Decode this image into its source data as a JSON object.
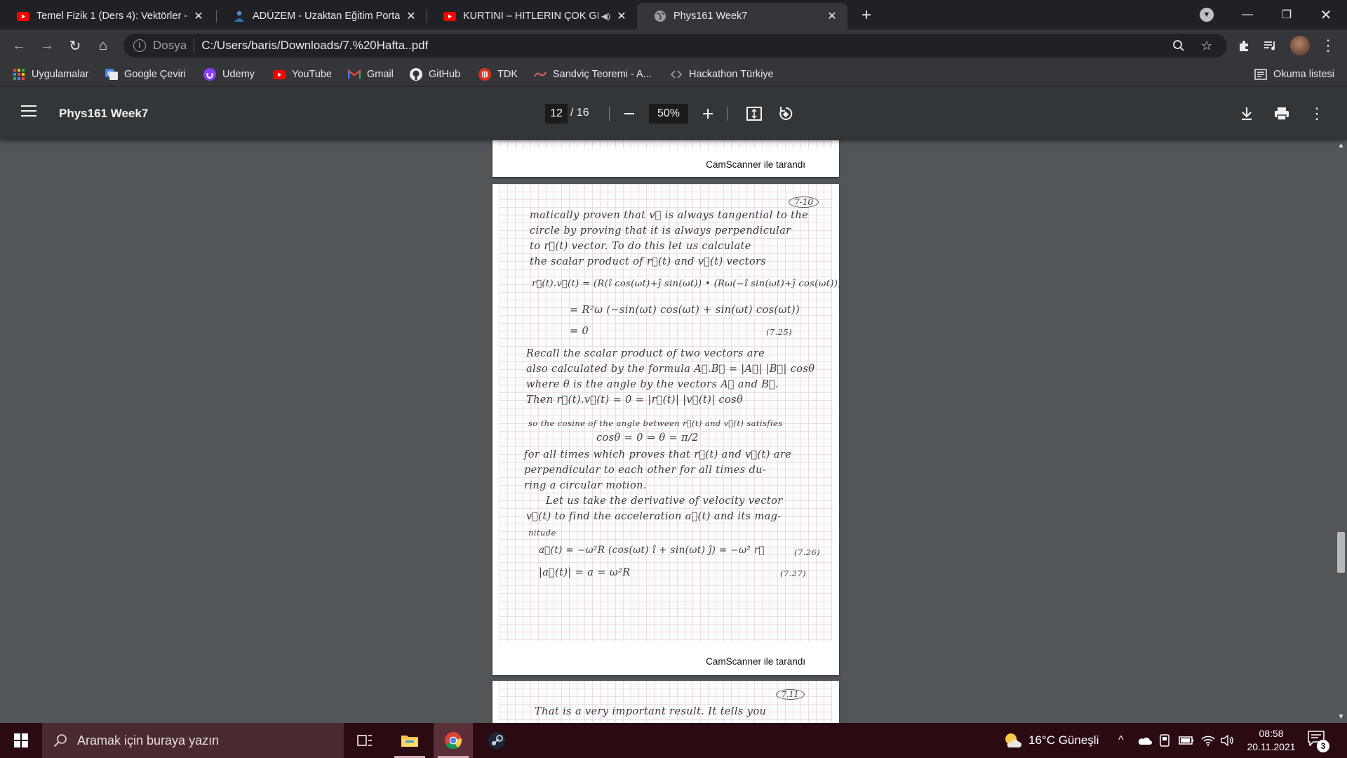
{
  "browser": {
    "tabs": [
      {
        "title": "Temel Fizik 1 (Ders 4): Vektörler -",
        "favicon": "youtube-icon"
      },
      {
        "title": "ADÜZEM - Uzaktan Eğitim Portalı",
        "favicon": "aduzem-icon"
      },
      {
        "title": "KURTİNİ – HİTLERİN ÇOK GİZ",
        "favicon": "youtube-icon",
        "audio": "speaker-icon"
      },
      {
        "title": "Phys161 Week7",
        "favicon": "globe-icon",
        "active": true
      }
    ],
    "address": {
      "scheme": "Dosya",
      "url": "C:/Users/baris/Downloads/7.%20Hafta..pdf"
    },
    "bookmarks": [
      {
        "label": "Uygulamalar",
        "icon": "apps-grid-icon"
      },
      {
        "label": "Google Çeviri",
        "icon": "google-translate-icon"
      },
      {
        "label": "Udemy",
        "icon": "udemy-icon"
      },
      {
        "label": "YouTube",
        "icon": "youtube-icon"
      },
      {
        "label": "Gmail",
        "icon": "gmail-icon"
      },
      {
        "label": "GitHub",
        "icon": "github-icon"
      },
      {
        "label": "TDK",
        "icon": "tdk-icon"
      },
      {
        "label": "Sandviç Teoremi - A...",
        "icon": "bookmark-page-icon"
      },
      {
        "label": "Hackathon Türkiye",
        "icon": "bookmark-page-icon"
      }
    ],
    "reading_list": "Okuma listesi"
  },
  "pdf": {
    "title": "Phys161 Week7",
    "current_page": "12",
    "total_pages": "/ 16",
    "zoom": "50%",
    "scan_footer": "CamScanner ile tarandı",
    "page_top_number": "7-10",
    "next_page_number": "7.11",
    "handwriting": [
      "matically proven that v⃗ is always tangential to the",
      "circle by proving that it is always perpendicular",
      "to r⃗(t) vector. To do this let us calculate",
      "the scalar product of r⃗(t) and v⃗(t) vectors",
      "r⃗(t).v⃗(t) = (R(î cos(ωt)+ĵ sin(ωt)) • (Rω(−î sin(ωt)+ĵ cos(ωt)))",
      "= R²ω (−sin(ωt) cos(ωt) + sin(ωt) cos(ωt))",
      "= 0",
      "(7.25)",
      "Recall the scalar product of two vectors are",
      "also calculated by the formula A⃗.B⃗ = |A⃗| |B⃗| cosθ",
      "where θ is the angle by the vectors A⃗ and B⃗.",
      "Then r⃗(t).v⃗(t) = 0 = |r⃗(t)| |v⃗(t)| cosθ",
      "so the cosine of the angle between r⃗(t) and v⃗(t) satisfies",
      "cosθ = 0  ⇒  θ = π/2",
      "for all times which proves that r⃗(t) and v⃗(t) are",
      "perpendicular to each other for all times du-",
      "ring a circular motion.",
      "Let us take the derivative of velocity vector",
      "v⃗(t) to find the acceleration a⃗(t) and its mag-",
      "nitude",
      "a⃗(t) = −ω²R (cos(ωt) î + sin(ωt) ĵ) = −ω² r⃗",
      "(7.26)",
      "|a⃗(t)| = a = ω²R",
      "(7.27)",
      "That is a very important result. It tells you"
    ]
  },
  "taskbar": {
    "search_placeholder": "Aramak için buraya yazın",
    "weather": "16°C  Güneşli",
    "time": "08:58",
    "date": "20.11.2021",
    "notification_count": "3"
  }
}
